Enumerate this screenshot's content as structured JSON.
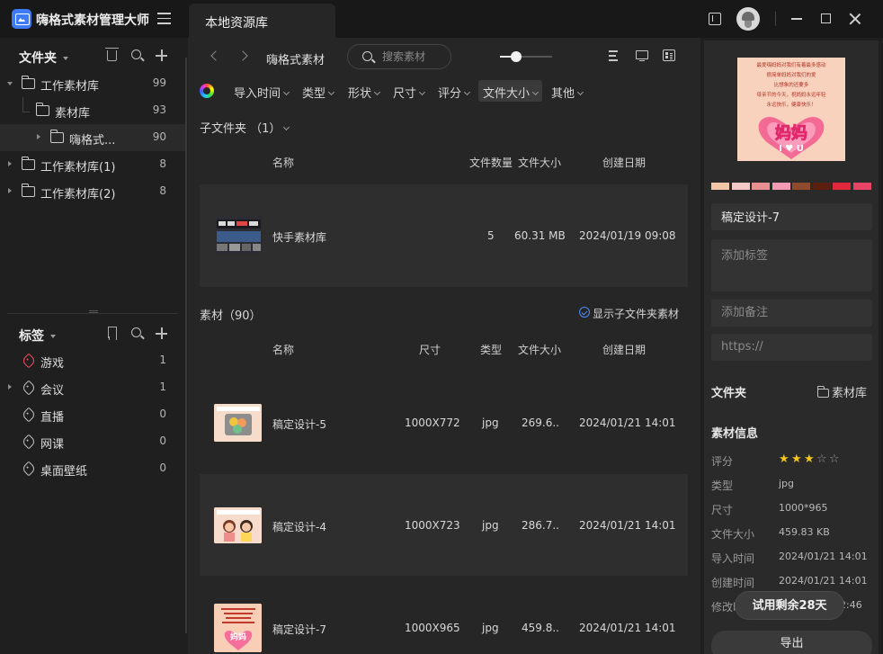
{
  "app": {
    "title": "嗨格式素材管理大师",
    "active_tab": "本地资源库"
  },
  "sidebar": {
    "folders_title": "文件夹",
    "folders": [
      {
        "name": "工作素材库",
        "count": "99",
        "expanded": true
      },
      {
        "name": "素材库",
        "count": "93",
        "expanded": true
      },
      {
        "name": "嗨格式...",
        "count": "90",
        "expanded": false
      },
      {
        "name": "工作素材库(1)",
        "count": "8",
        "expanded": false
      },
      {
        "name": "工作素材库(2)",
        "count": "8",
        "expanded": false
      }
    ],
    "tags_title": "标签",
    "tags": [
      {
        "name": "游戏",
        "count": "1",
        "color": "#ef4b5c"
      },
      {
        "name": "会议",
        "count": "1"
      },
      {
        "name": "直播",
        "count": "0"
      },
      {
        "name": "网课",
        "count": "0"
      },
      {
        "name": "桌面壁纸",
        "count": "0"
      }
    ]
  },
  "main": {
    "breadcrumb": "嗨格式素材",
    "search_placeholder": "搜索素材",
    "zoom_level": 0.27,
    "filters": [
      "导入时间",
      "类型",
      "形状",
      "尺寸",
      "评分",
      "文件大小",
      "其他"
    ],
    "active_filter": "文件大小",
    "subfolders_title": "子文件夹  （1）",
    "subfolder_columns": {
      "name": "名称",
      "count": "文件数量",
      "size": "文件大小",
      "date": "创建日期"
    },
    "subfolders": [
      {
        "name": "快手素材库",
        "count": "5",
        "size": "60.31 MB",
        "date": "2024/01/19 09:08"
      }
    ],
    "assets_title": "素材（90）",
    "show_subfolder_assets": "显示子文件夹素材",
    "asset_columns": {
      "name": "名称",
      "dims": "尺寸",
      "type": "类型",
      "size": "文件大小",
      "date": "创建日期"
    },
    "assets": [
      {
        "name": "稿定设计-5",
        "dims": "1000X772",
        "type": "jpg",
        "size": "269.6..",
        "date": "2024/01/21 14:01"
      },
      {
        "name": "稿定设计-4",
        "dims": "1000X723",
        "type": "jpg",
        "size": "286.7..",
        "date": "2024/01/21 14:01"
      },
      {
        "name": "稿定设计-7",
        "dims": "1000X965",
        "type": "jpg",
        "size": "459.8..",
        "date": "2024/01/21 14:01"
      }
    ]
  },
  "details": {
    "preview_text": [
      "最爱嗨妈妈对我们有着最多感动",
      "很简单妈妈对我们的爱",
      "比想象的还要多",
      "母亲节的今天，祝妈妈永远年轻",
      "永远快乐，健康快乐！"
    ],
    "preview_big_text": "妈妈",
    "preview_love": "I ♥ U",
    "palette": [
      "#f2c6a6",
      "#f4c9c6",
      "#e88f91",
      "#f49ab4",
      "#8f4a2c",
      "#5b1f10",
      "#e0283c",
      "#e84466"
    ],
    "name_value": "稿定设计-7",
    "tags_placeholder": "添加标签",
    "note_placeholder": "添加备注",
    "url_placeholder": "https://",
    "folder_label": "文件夹",
    "folder_value": "素材库",
    "info_title": "素材信息",
    "rating_label": "评分",
    "rating": 3,
    "rating_max": 5,
    "rows": [
      {
        "label": "类型",
        "value": "jpg"
      },
      {
        "label": "尺寸",
        "value": "1000*965"
      },
      {
        "label": "文件大小",
        "value": "459.83 KB"
      },
      {
        "label": "导入时间",
        "value": "2024/01/21 14:01"
      },
      {
        "label": "创建时间",
        "value": "2024/01/21 14:01"
      },
      {
        "label": "修改时间",
        "value": "2:46"
      }
    ],
    "trial_label": "试用剩余28天",
    "export_label": "导出"
  }
}
